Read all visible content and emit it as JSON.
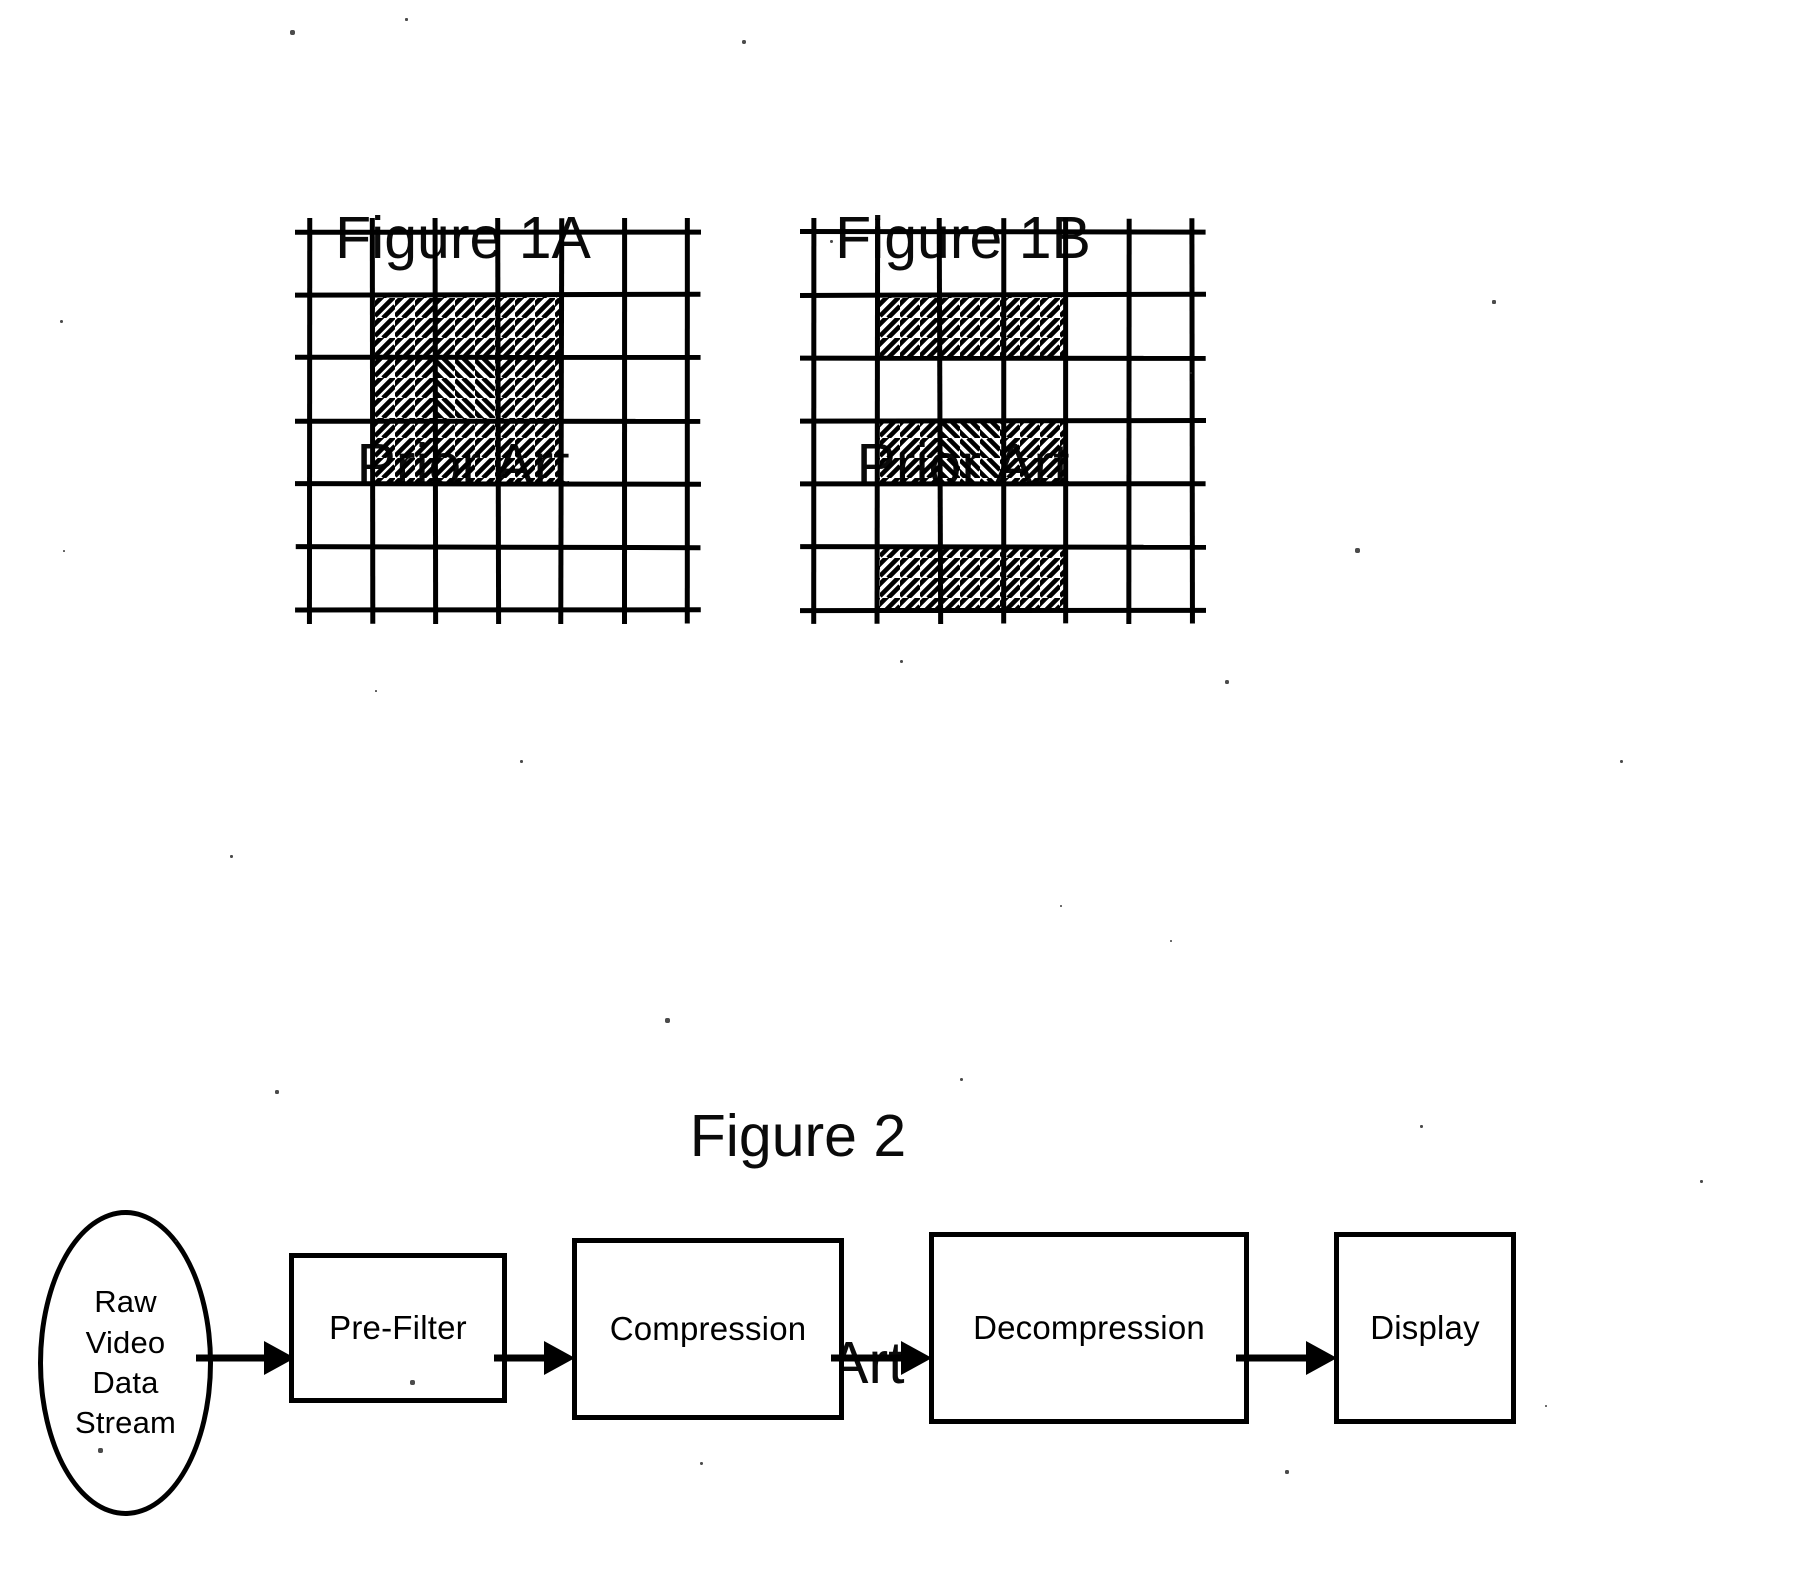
{
  "document": {
    "kind": "patent-drawing-sheet",
    "background_color": "#ffffff",
    "ink_color": "#000000"
  },
  "figures": [
    {
      "id": "1A",
      "title_line1": "Figure 1A",
      "title_line2": "Prior Art",
      "grid": {
        "columns": 6,
        "rows": 6,
        "cell_size": 63,
        "line_color": "#000000",
        "hatched_cells": [
          {
            "row": 1,
            "col": 1,
            "hatch": "forward"
          },
          {
            "row": 1,
            "col": 2,
            "hatch": "forward"
          },
          {
            "row": 1,
            "col": 3,
            "hatch": "forward"
          },
          {
            "row": 2,
            "col": 1,
            "hatch": "forward"
          },
          {
            "row": 2,
            "col": 2,
            "hatch": "reverse"
          },
          {
            "row": 2,
            "col": 3,
            "hatch": "forward"
          },
          {
            "row": 3,
            "col": 1,
            "hatch": "forward"
          },
          {
            "row": 3,
            "col": 2,
            "hatch": "forward"
          },
          {
            "row": 3,
            "col": 3,
            "hatch": "forward"
          }
        ]
      }
    },
    {
      "id": "1B",
      "title_line1": "Figure 1B",
      "title_line2": "Prior Art",
      "grid": {
        "columns": 6,
        "rows": 6,
        "cell_size": 63,
        "line_color": "#000000",
        "hatched_cells": [
          {
            "row": 1,
            "col": 1,
            "hatch": "forward"
          },
          {
            "row": 1,
            "col": 2,
            "hatch": "forward"
          },
          {
            "row": 1,
            "col": 3,
            "hatch": "forward"
          },
          {
            "row": 3,
            "col": 1,
            "hatch": "forward"
          },
          {
            "row": 3,
            "col": 2,
            "hatch": "reverse"
          },
          {
            "row": 3,
            "col": 3,
            "hatch": "forward"
          },
          {
            "row": 5,
            "col": 1,
            "hatch": "forward"
          },
          {
            "row": 5,
            "col": 2,
            "hatch": "forward"
          },
          {
            "row": 5,
            "col": 3,
            "hatch": "forward"
          }
        ]
      }
    },
    {
      "id": "2",
      "title_line1": "Figure 2",
      "title_line2": "Prior Art",
      "flow": {
        "nodes": [
          {
            "shape": "oval",
            "label": "Raw\nVideo\nData\nStream"
          },
          {
            "shape": "rect",
            "label": "Pre-Filter"
          },
          {
            "shape": "rect",
            "label": "Compression"
          },
          {
            "shape": "rect",
            "label": "Decompression"
          },
          {
            "shape": "rect",
            "label": "Display"
          }
        ],
        "connector_style": "solid-arrow-right",
        "connector_count": 4
      }
    }
  ]
}
